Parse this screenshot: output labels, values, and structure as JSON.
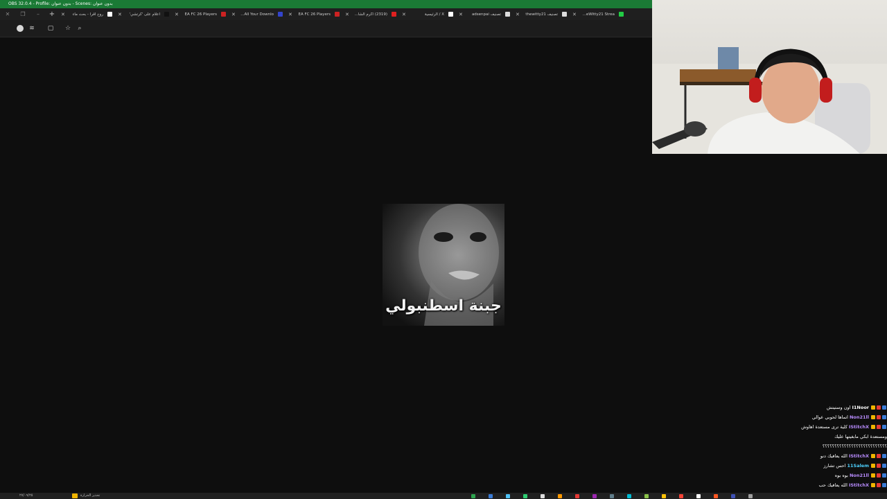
{
  "obs": {
    "title": "OBS 32.0.4 - Profile: بدون عنوان - Scenes: بدون عنوان"
  },
  "browser": {
    "tabs": [
      {
        "label": "روح اقرأ - بحث ماء",
        "color": "#ffffff"
      },
      {
        "label": "اعلام على 'كرتشي'",
        "color": "#111111"
      },
      {
        "label": "EA FC 26 Players",
        "color": "#cc2222"
      },
      {
        "label": "All Your Downlo...",
        "color": "#3344cc"
      },
      {
        "label": "EA FC 26 Players",
        "color": "#cc2222"
      },
      {
        "label": "(2319) اكرم الشاء...",
        "color": "#e02020"
      },
      {
        "label": "X / الرئيسية",
        "color": "#ffffff"
      },
      {
        "label": "تصنيف adsenpai",
        "color": "#dddddd"
      },
      {
        "label": "تصنيف thewitty21",
        "color": "#dddddd"
      },
      {
        "label": "TheWitty21 Strea...",
        "color": "#22cc44"
      }
    ]
  },
  "meme": {
    "caption": "جبنة اسطنبولي"
  },
  "chat": {
    "messages": [
      {
        "user": "I1Noor",
        "color": "#ffffff",
        "text": "اون وستيتش"
      },
      {
        "user": "Non21ll",
        "color": "#b98cff",
        "text": "اتماها لحوبي عوالي"
      },
      {
        "user": "IStitchX",
        "color": "#b98cff",
        "text": "كلية ترى مستعدة اهاوش"
      },
      {
        "user": "",
        "color": "#ffffff",
        "text": "ومستعدة ابكي مابغيتها عليك"
      },
      {
        "user": "",
        "color": "#ffffff",
        "text": "؟؟؟؟؟؟؟؟؟؟؟؟؟؟؟؟؟؟؟؟؟؟؟؟؟؟؟"
      },
      {
        "user": "IStitchX",
        "color": "#b98cff",
        "text": "الله يعافيك دنو"
      },
      {
        "user": "11Salem",
        "color": "#4dd0ff",
        "text": "احس تشارز"
      },
      {
        "user": "Non21ll",
        "color": "#b98cff",
        "text": "بوه بوه"
      },
      {
        "user": "IStitchX",
        "color": "#b98cff",
        "text": "الله يعافيك حب"
      }
    ]
  },
  "taskbar": {
    "clock": "٢٧/٠٩/٢٥",
    "weather": "تحذير الحرارة"
  }
}
